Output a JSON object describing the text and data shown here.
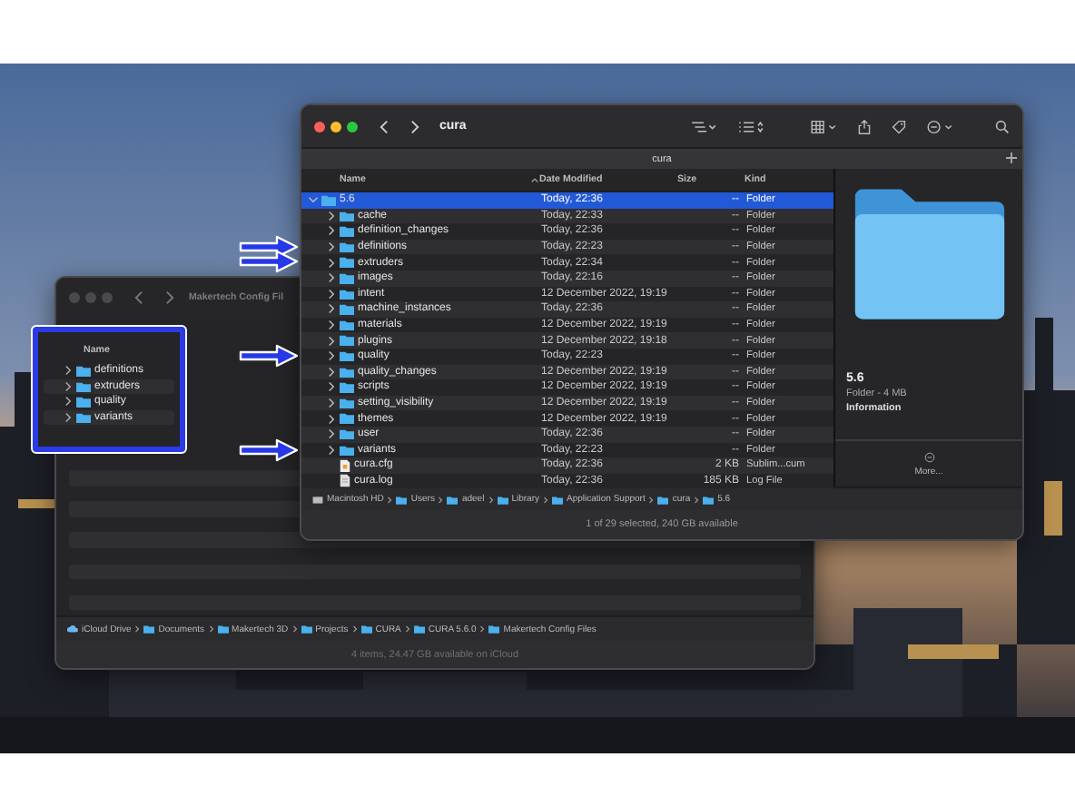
{
  "back_window": {
    "title": "Makertech Config Fil",
    "column": "Name",
    "rows": [
      {
        "name": "definitions",
        "expanded": false,
        "selected": false
      },
      {
        "name": "extruders",
        "expanded": false,
        "selected": false
      },
      {
        "name": "quality",
        "expanded": false,
        "selected": false
      },
      {
        "name": "variants",
        "expanded": false,
        "selected": false
      }
    ],
    "path": [
      {
        "label": "iCloud Drive",
        "kind": "cloud"
      },
      {
        "label": "Documents",
        "kind": "folder"
      },
      {
        "label": "Makertech 3D",
        "kind": "folder"
      },
      {
        "label": "Projects",
        "kind": "folder"
      },
      {
        "label": "CURA",
        "kind": "folder"
      },
      {
        "label": "CURA 5.6.0",
        "kind": "folder"
      },
      {
        "label": "Makertech Config Files",
        "kind": "folder"
      }
    ],
    "status": "4 items, 24.47 GB available on iCloud"
  },
  "front_window": {
    "title": "cura",
    "tab": "cura",
    "columns": [
      "Name",
      "Date Modified",
      "Size",
      "Kind"
    ],
    "rows": [
      {
        "name": "5.6",
        "date": "Today, 22:36",
        "size": "--",
        "kind_label": "Folder",
        "kind": "dir",
        "expanded": true,
        "selected": true,
        "marked": false,
        "children": [
          {
            "name": "cache",
            "date": "Today, 22:33",
            "size": "--",
            "kind_label": "Folder",
            "kind": "dir",
            "expanded": false,
            "selected": false,
            "marked": false
          },
          {
            "name": "definition_changes",
            "date": "Today, 22:36",
            "size": "--",
            "kind_label": "Folder",
            "kind": "dir",
            "expanded": false,
            "selected": false,
            "marked": false
          },
          {
            "name": "definitions",
            "date": "Today, 22:23",
            "size": "--",
            "kind_label": "Folder",
            "kind": "dir",
            "expanded": false,
            "selected": false,
            "marked": true
          },
          {
            "name": "extruders",
            "date": "Today, 22:34",
            "size": "--",
            "kind_label": "Folder",
            "kind": "dir",
            "expanded": false,
            "selected": false,
            "marked": true
          },
          {
            "name": "images",
            "date": "Today, 22:16",
            "size": "--",
            "kind_label": "Folder",
            "kind": "dir",
            "expanded": false,
            "selected": false,
            "marked": false
          },
          {
            "name": "intent",
            "date": "12 December 2022, 19:19",
            "size": "--",
            "kind_label": "Folder",
            "kind": "dir",
            "expanded": false,
            "selected": false,
            "marked": false
          },
          {
            "name": "machine_instances",
            "date": "Today, 22:36",
            "size": "--",
            "kind_label": "Folder",
            "kind": "dir",
            "expanded": false,
            "selected": false,
            "marked": false
          },
          {
            "name": "materials",
            "date": "12 December 2022, 19:19",
            "size": "--",
            "kind_label": "Folder",
            "kind": "dir",
            "expanded": false,
            "selected": false,
            "marked": false
          },
          {
            "name": "plugins",
            "date": "12 December 2022, 19:18",
            "size": "--",
            "kind_label": "Folder",
            "kind": "dir",
            "expanded": false,
            "selected": false,
            "marked": false
          },
          {
            "name": "quality",
            "date": "Today, 22:23",
            "size": "--",
            "kind_label": "Folder",
            "kind": "dir",
            "expanded": false,
            "selected": false,
            "marked": true
          },
          {
            "name": "quality_changes",
            "date": "12 December 2022, 19:19",
            "size": "--",
            "kind_label": "Folder",
            "kind": "dir",
            "expanded": false,
            "selected": false,
            "marked": false
          },
          {
            "name": "scripts",
            "date": "12 December 2022, 19:19",
            "size": "--",
            "kind_label": "Folder",
            "kind": "dir",
            "expanded": false,
            "selected": false,
            "marked": false
          },
          {
            "name": "setting_visibility",
            "date": "12 December 2022, 19:19",
            "size": "--",
            "kind_label": "Folder",
            "kind": "dir",
            "expanded": false,
            "selected": false,
            "marked": false
          },
          {
            "name": "themes",
            "date": "12 December 2022, 19:19",
            "size": "--",
            "kind_label": "Folder",
            "kind": "dir",
            "expanded": false,
            "selected": false,
            "marked": false
          },
          {
            "name": "user",
            "date": "Today, 22:36",
            "size": "--",
            "kind_label": "Folder",
            "kind": "dir",
            "expanded": false,
            "selected": false,
            "marked": false
          },
          {
            "name": "variants",
            "date": "Today, 22:23",
            "size": "--",
            "kind_label": "Folder",
            "kind": "dir",
            "expanded": false,
            "selected": false,
            "marked": true
          },
          {
            "name": "cura.cfg",
            "date": "Today, 22:36",
            "size": "2 KB",
            "kind_label": "Sublim...cum",
            "kind": "cfg",
            "selected": false,
            "marked": false
          },
          {
            "name": "cura.log",
            "date": "Today, 22:36",
            "size": "185 KB",
            "kind_label": "Log File",
            "kind": "log",
            "selected": false,
            "marked": false
          }
        ]
      }
    ],
    "preview": {
      "name": "5.6",
      "info": "Folder - 4 MB",
      "section": "Information",
      "more": "More..."
    },
    "path": [
      {
        "label": "Macintosh HD",
        "kind": "disk"
      },
      {
        "label": "Users",
        "kind": "folder"
      },
      {
        "label": "adeel",
        "kind": "folder"
      },
      {
        "label": "Library",
        "kind": "folder"
      },
      {
        "label": "Application Support",
        "kind": "folder"
      },
      {
        "label": "cura",
        "kind": "folder"
      },
      {
        "label": "5.6",
        "kind": "folder"
      }
    ],
    "status": "1 of 29 selected, 240 GB available"
  }
}
